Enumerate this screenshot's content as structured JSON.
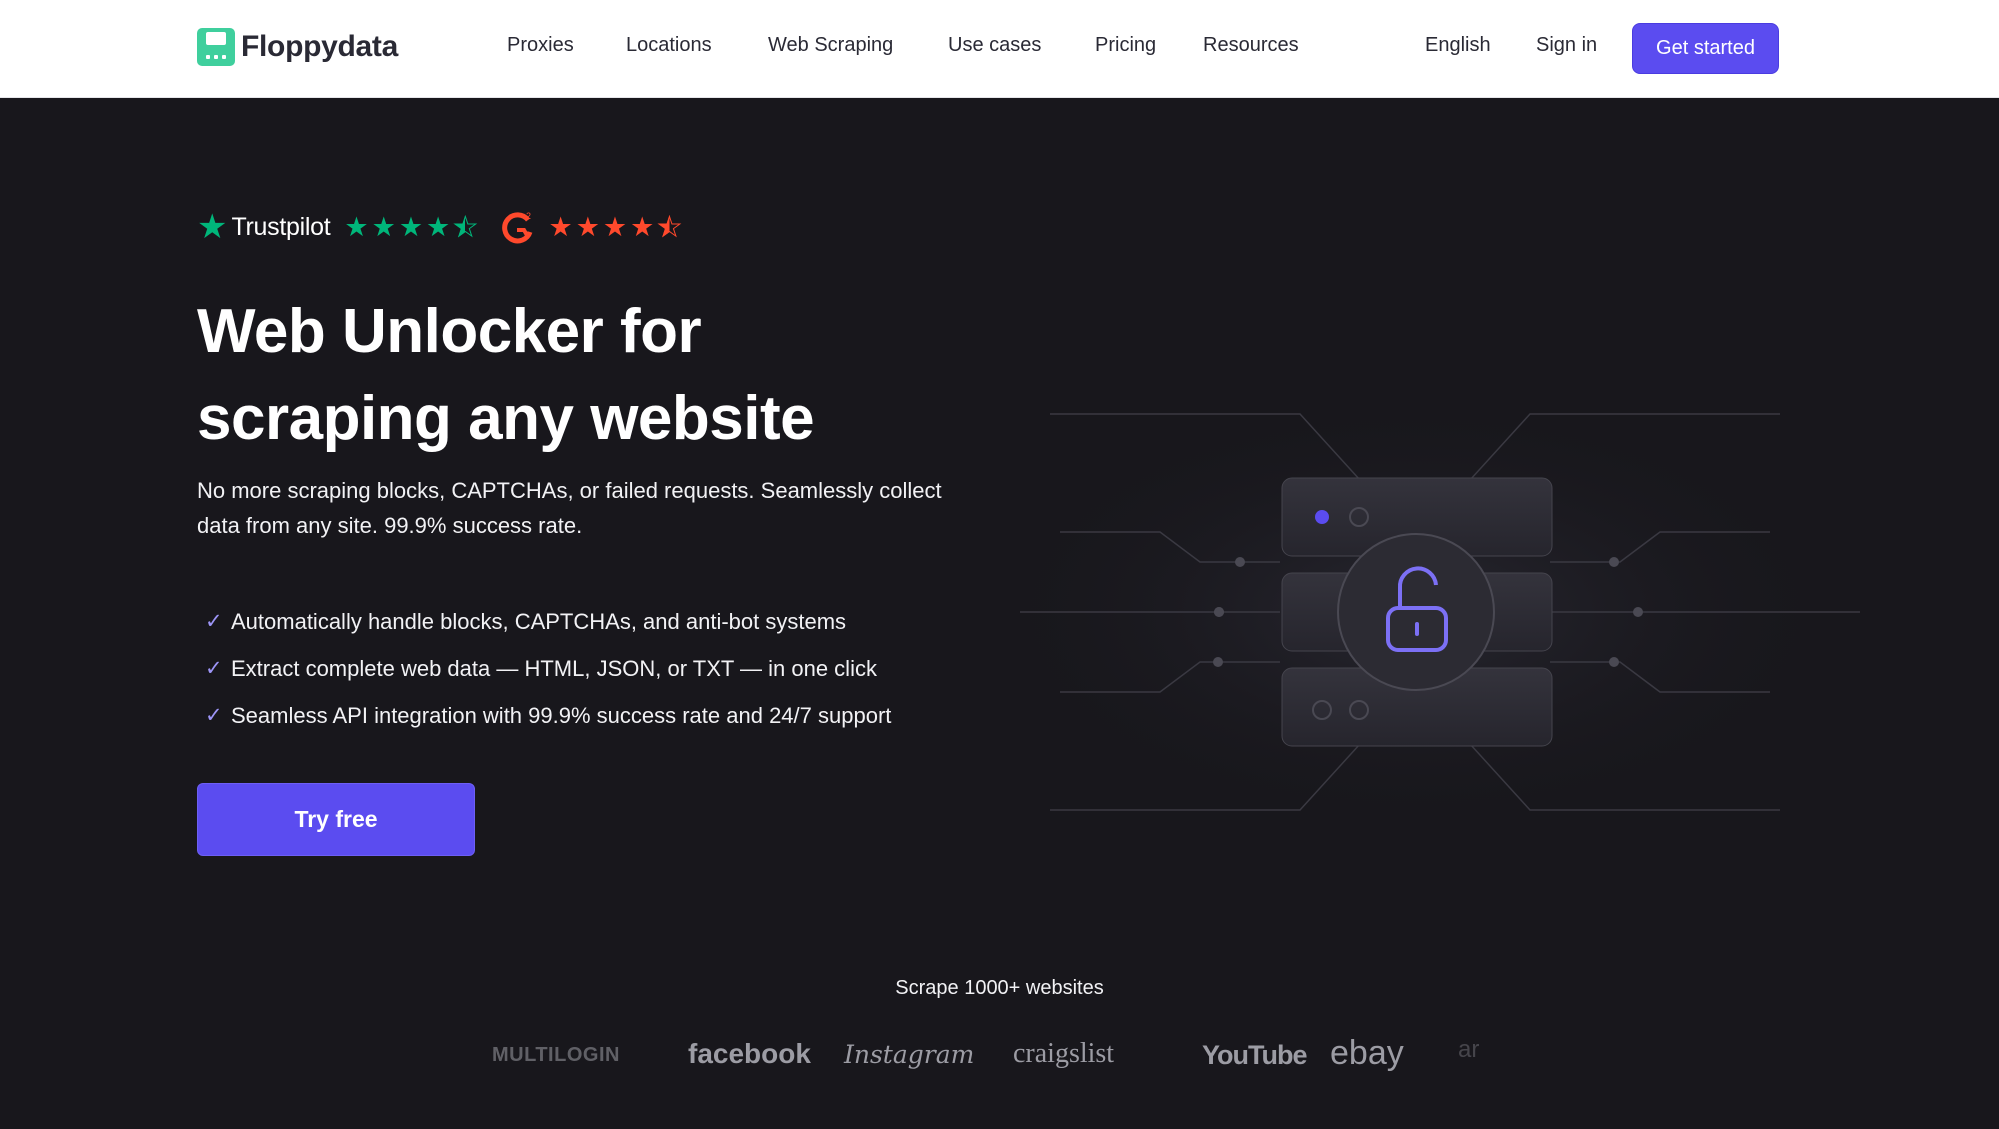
{
  "header": {
    "logo_text": "Floppydata",
    "nav": [
      "Proxies",
      "Locations",
      "Web Scraping",
      "Use cases",
      "Pricing",
      "Resources"
    ],
    "language": "English",
    "sign_in": "Sign in",
    "get_started": "Get started"
  },
  "ratings": {
    "trustpilot_label": "Trustpilot",
    "trustpilot_stars": 4.5,
    "g2_stars": 4.5
  },
  "hero": {
    "title_line1": "Web Unlocker for",
    "title_line2": "scraping any website",
    "subtitle": "No more scraping blocks, CAPTCHAs, or failed requests. Seamlessly collect data from any site. 99.9% success rate.",
    "features": [
      "Automatically handle blocks, CAPTCHAs, and anti-bot systems",
      "Extract complete web data — HTML, JSON, or TXT — in one click",
      "Seamless API integration with 99.9% success rate and 24/7 support"
    ],
    "cta": "Try free"
  },
  "brands_section": {
    "label": "Scrape 1000+ websites",
    "brands": [
      "MULTILOGIN",
      "facebook",
      "Instagram",
      "craigslist",
      "YouTube",
      "ebay",
      "ar"
    ]
  },
  "colors": {
    "accent": "#5b4cf0",
    "trustpilot_green": "#00b67a",
    "g2_red": "#ff492c",
    "background": "#18171c"
  }
}
